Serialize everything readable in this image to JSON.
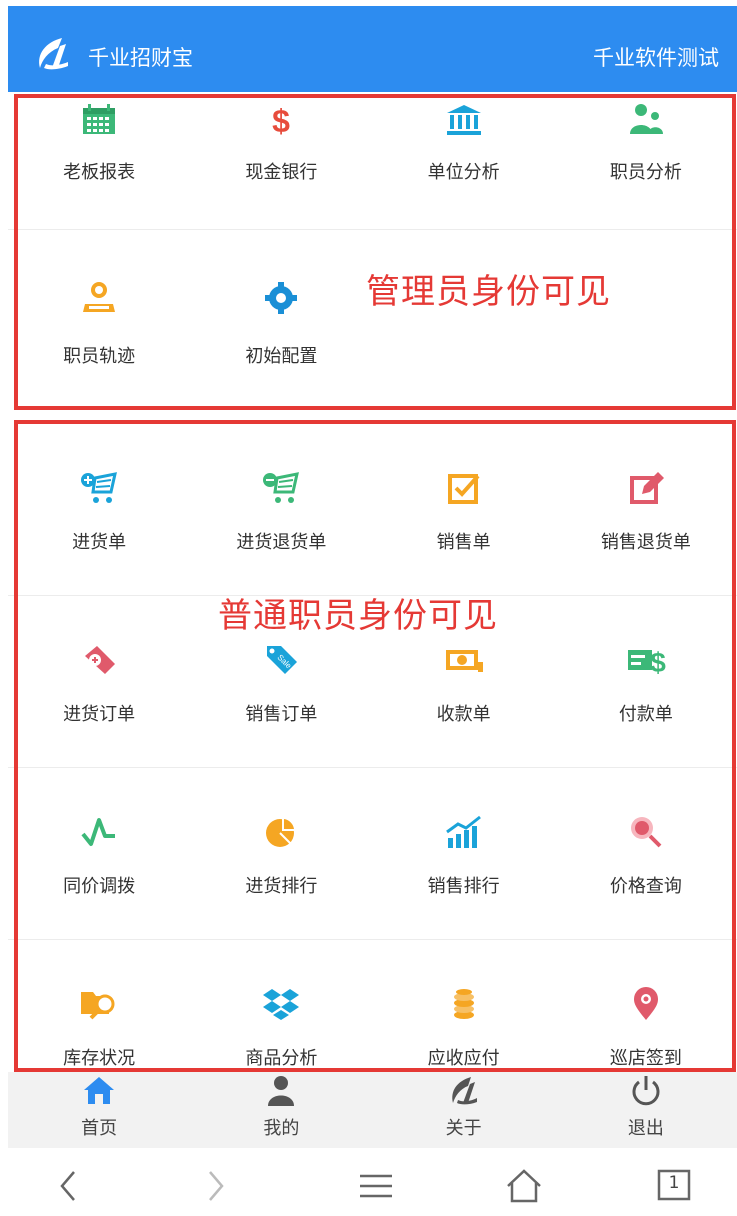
{
  "header": {
    "app_title": "千业招财宝",
    "org_name": "千业软件测试",
    "bg_color": "#2d8cf0"
  },
  "annotations": {
    "admin_visible": "管理员身份可见",
    "staff_visible": "普通职员身份可见",
    "color": "#e53935"
  },
  "admin_grid": [
    {
      "label": "老板报表",
      "icon": "calendar-icon",
      "color": "#3cb878"
    },
    {
      "label": "现金银行",
      "icon": "dollar-icon",
      "color": "#e74c3c"
    },
    {
      "label": "单位分析",
      "icon": "bank-icon",
      "color": "#1aa3d9"
    },
    {
      "label": "职员分析",
      "icon": "users-icon",
      "color": "#3cb878"
    },
    {
      "label": "职员轨迹",
      "icon": "location-user-icon",
      "color": "#f5a623"
    },
    {
      "label": "初始配置",
      "icon": "gear-icon",
      "color": "#1a8fd6"
    }
  ],
  "staff_grid": [
    {
      "label": "进货单",
      "icon": "cart-plus-icon",
      "color": "#1aa3d9"
    },
    {
      "label": "进货退货单",
      "icon": "cart-minus-icon",
      "color": "#3cb878"
    },
    {
      "label": "销售单",
      "icon": "checkbox-edit-icon",
      "color": "#f5a623"
    },
    {
      "label": "销售退货单",
      "icon": "edit-icon",
      "color": "#e05a6b"
    },
    {
      "label": "进货订单",
      "icon": "tag-plus-icon",
      "color": "#e05a6b"
    },
    {
      "label": "销售订单",
      "icon": "sale-tag-icon",
      "color": "#1aa3d9"
    },
    {
      "label": "收款单",
      "icon": "money-icon",
      "color": "#f5a623"
    },
    {
      "label": "付款单",
      "icon": "pay-icon",
      "color": "#3cb878"
    },
    {
      "label": "同价调拨",
      "icon": "pulse-icon",
      "color": "#3cb878"
    },
    {
      "label": "进货排行",
      "icon": "pie-chart-icon",
      "color": "#f5a623"
    },
    {
      "label": "销售排行",
      "icon": "bar-trend-icon",
      "color": "#1aa3d9"
    },
    {
      "label": "价格查询",
      "icon": "search-price-icon",
      "color": "#e05a6b"
    },
    {
      "label": "库存状况",
      "icon": "folder-search-icon",
      "color": "#f5a623"
    },
    {
      "label": "商品分析",
      "icon": "dropbox-icon",
      "color": "#1aa3d9"
    },
    {
      "label": "应收应付",
      "icon": "coins-icon",
      "color": "#f5a623"
    },
    {
      "label": "巡店签到",
      "icon": "map-pin-icon",
      "color": "#e05a6b"
    }
  ],
  "tabbar": [
    {
      "label": "首页",
      "icon": "home-icon",
      "active": true
    },
    {
      "label": "我的",
      "icon": "person-icon",
      "active": false
    },
    {
      "label": "关于",
      "icon": "logo-icon",
      "active": false
    },
    {
      "label": "退出",
      "icon": "power-icon",
      "active": false
    }
  ],
  "system_nav": [
    {
      "icon": "back-icon"
    },
    {
      "icon": "forward-icon"
    },
    {
      "icon": "menu-icon"
    },
    {
      "icon": "home-outline-icon"
    },
    {
      "icon": "tabs-icon",
      "count": "1"
    }
  ]
}
